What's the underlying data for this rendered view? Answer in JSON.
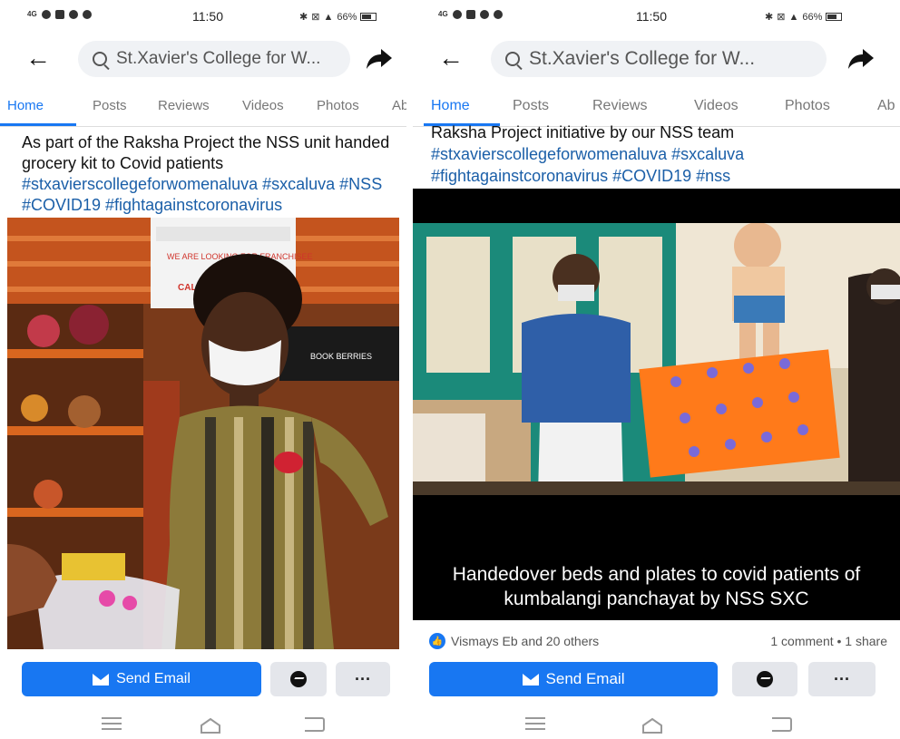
{
  "left": {
    "status": {
      "time": "11:50",
      "signal": "4G",
      "battery": "66%"
    },
    "search": {
      "text": "St.Xavier's College for W..."
    },
    "tabs": [
      "Home",
      "Posts",
      "Reviews",
      "Videos",
      "Photos",
      "Ab"
    ],
    "post": {
      "text": "As part of the Raksha Project the NSS unit handed grocery kit to Covid patients",
      "hashtags": "#stxavierscollegeforwomenaluva #sxcaluva #NSS #COVID19 #fightagainstcoronavirus"
    },
    "photo": {
      "sign_text": "WE ARE LOOKING FOR FRANCHISEE",
      "sign_text2": "CALL",
      "shelf_label": "BOOK BERRIES"
    },
    "actions": {
      "email_label": "Send Email",
      "more_label": "···"
    }
  },
  "right": {
    "status": {
      "time": "11:50",
      "signal": "4G",
      "battery": "66%"
    },
    "search": {
      "text": "St.Xavier's College for W..."
    },
    "tabs": [
      "Home",
      "Posts",
      "Reviews",
      "Videos",
      "Photos",
      "Ab"
    ],
    "post": {
      "text_top": "Raksha Project initiative by our NSS team",
      "hashtags": "#stxavierscollegeforwomenaluva #sxcaluva #fightagainstcoronavirus #COVID19 #nss"
    },
    "caption": "Handedover beds and plates to covid patients of kumbalangi panchayat by NSS SXC",
    "reactions": {
      "likes": "Vismays Eb and 20 others",
      "counts": "1 comment • 1 share"
    },
    "actions": {
      "email_label": "Send Email",
      "more_label": "···"
    }
  },
  "colors": {
    "brand": "#1877f2",
    "hashtag": "#1b5fa8"
  }
}
